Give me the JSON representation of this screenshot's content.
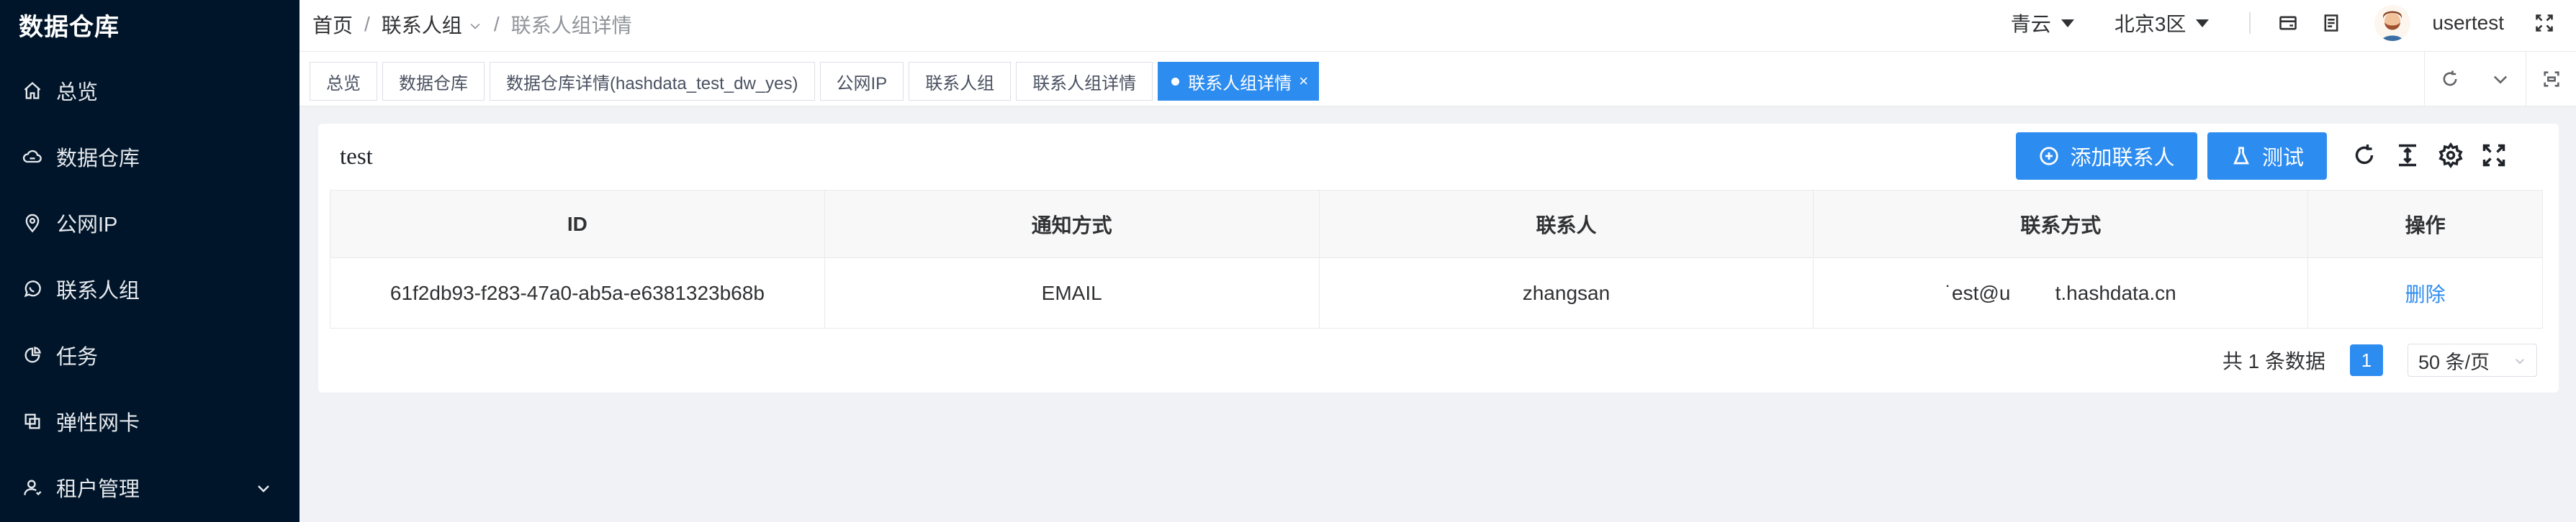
{
  "sidebar": {
    "brand": "数据仓库",
    "items": [
      {
        "label": "总览",
        "icon": "home-icon"
      },
      {
        "label": "数据仓库",
        "icon": "cloud-icon"
      },
      {
        "label": "公网IP",
        "icon": "location-icon"
      },
      {
        "label": "联系人组",
        "icon": "chat-icon"
      },
      {
        "label": "任务",
        "icon": "pie-chart-icon"
      },
      {
        "label": "弹性网卡",
        "icon": "copy-icon"
      },
      {
        "label": "租户管理",
        "icon": "user-icon"
      }
    ]
  },
  "header": {
    "breadcrumb": [
      "首页",
      "联系人组",
      "联系人组详情"
    ],
    "region": "青云",
    "zone": "北京3区",
    "username": "usertest"
  },
  "tabs": [
    {
      "label": "总览"
    },
    {
      "label": "数据仓库"
    },
    {
      "label": "数据仓库详情(hashdata_test_dw_yes)"
    },
    {
      "label": "公网IP"
    },
    {
      "label": "联系人组"
    },
    {
      "label": "联系人组详情"
    },
    {
      "label": "联系人组详情",
      "close": "×"
    }
  ],
  "card": {
    "title": "test",
    "add_button": "添加联系人",
    "test_button": "测试"
  },
  "table": {
    "columns": [
      "ID",
      "通知方式",
      "联系人",
      "联系方式",
      "操作"
    ],
    "rows": [
      {
        "id": "61f2db93-f283-47a0-ab5a-e6381323b68b",
        "method": "EMAIL",
        "contact": "zhangsan",
        "contact_info": "˙est@u        t.hashdata.cn",
        "action": "删除"
      }
    ]
  },
  "pagination": {
    "total": "共 1 条数据",
    "current": "1",
    "page_size": "50 条/页"
  },
  "colors": {
    "sidebar_bg": "#001529",
    "primary": "#2d8cf0",
    "page_bg": "#f0f2f5"
  }
}
